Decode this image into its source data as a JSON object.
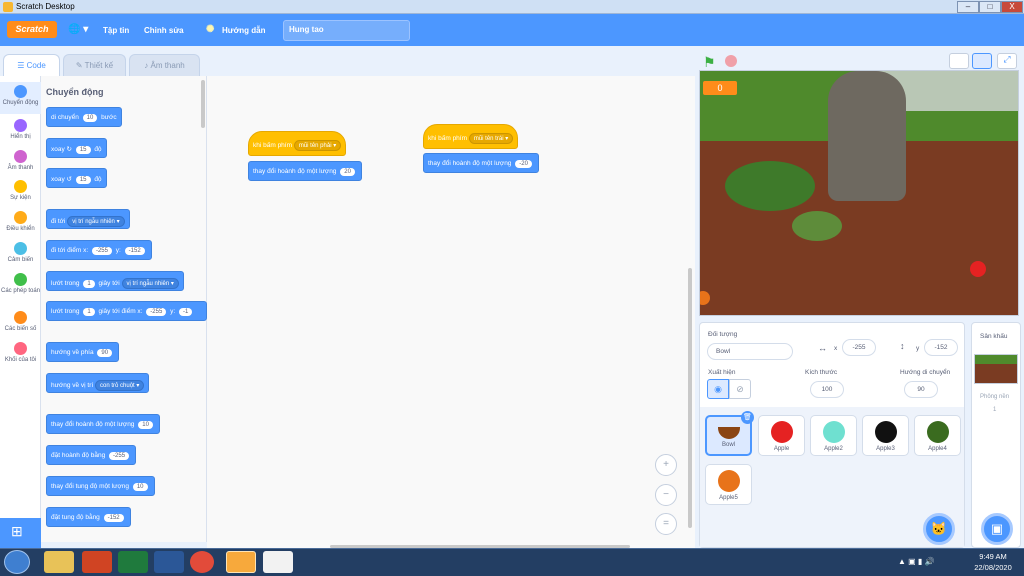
{
  "window": {
    "title": "Scratch Desktop",
    "min": "–",
    "max": "□",
    "close": "X"
  },
  "menubar": {
    "logo": "Scratch",
    "globe": "🌐 ▾",
    "file": "Tập tin",
    "edit": "Chỉnh sửa",
    "tutorials": "Hướng dẫn",
    "project_name": "Hung tao"
  },
  "tabs": {
    "code": "Code",
    "costumes": "Thiết kế",
    "sounds": "Âm thanh"
  },
  "categories": [
    {
      "label": "Chuyển động",
      "color": "#4c97ff"
    },
    {
      "label": "Hiển thị",
      "color": "#9966ff"
    },
    {
      "label": "Âm thanh",
      "color": "#cf63cf"
    },
    {
      "label": "Sự kiện",
      "color": "#ffbf00"
    },
    {
      "label": "Điều khiển",
      "color": "#ffab19"
    },
    {
      "label": "Cảm biến",
      "color": "#4cbfe6"
    },
    {
      "label": "Các phép toán",
      "color": "#40bf4a"
    },
    {
      "label": "Các biến số",
      "color": "#ff8c1a"
    },
    {
      "label": "Khối của tôi",
      "color": "#ff6680"
    }
  ],
  "palette": {
    "heading": "Chuyển động",
    "blocks": {
      "move": {
        "pre": "di chuyển",
        "v1": "10",
        "post": "bước"
      },
      "turn_right": {
        "pre": "xoay",
        "v1": "15",
        "post": "độ"
      },
      "turn_left": {
        "pre": "xoay",
        "v1": "15",
        "post": "độ"
      },
      "goto": {
        "pre": "đi tới",
        "dd": "vị trí ngẫu nhiên ▾"
      },
      "goto_xy": {
        "pre": "đi tới điểm x:",
        "v1": "-255",
        "mid": "y:",
        "v2": "-152"
      },
      "glide": {
        "pre": "lướt trong",
        "v1": "1",
        "mid": "giây tới",
        "dd": "vị trí ngẫu nhiên ▾"
      },
      "glide_xy": {
        "pre": "lướt trong",
        "v1": "1",
        "mid": "giây tới điểm x:",
        "v2": "-255",
        "end": "y:",
        "v3": "-1"
      },
      "point_dir": {
        "pre": "hướng về phía",
        "v1": "90"
      },
      "point_to": {
        "pre": "hướng về vị trí",
        "dd": "con trỏ chuột ▾"
      },
      "change_x": {
        "pre": "thay đổi hoành độ một lượng",
        "v1": "10"
      },
      "set_x": {
        "pre": "đặt hoành độ bằng",
        "v1": "-255"
      },
      "change_y": {
        "pre": "thay đổi tung độ một lượng",
        "v1": "10"
      },
      "set_y": {
        "pre": "đặt tung độ bằng",
        "v1": "-152"
      }
    }
  },
  "scripts": [
    {
      "hat": "khi bấm phím",
      "key": "mũi tên phải ▾",
      "action": "thay đổi hoành độ một lượng",
      "value": "20"
    },
    {
      "hat": "khi bấm phím",
      "key": "mũi tên trái ▾",
      "action": "thay đổi hoành độ một lượng",
      "value": "-20"
    }
  ],
  "zoom": {
    "in": "+",
    "out": "−",
    "reset": "="
  },
  "stage": {
    "score": "0"
  },
  "sprite_info": {
    "sprite_label": "Đối tượng",
    "sprite_name": "Bowl",
    "x_label": "x",
    "x_value": "-255",
    "y_label": "y",
    "y_value": "-152",
    "show_label": "Xuất hiện",
    "size_label": "Kích thước",
    "size_value": "100",
    "direction_label": "Hướng di chuyển",
    "direction_value": "90"
  },
  "sprites": [
    {
      "name": "Bowl",
      "color": "#8b4513"
    },
    {
      "name": "Apple",
      "color": "#e52222"
    },
    {
      "name": "Apple2",
      "color": "#6fe0d0"
    },
    {
      "name": "Apple3",
      "color": "#111111"
    },
    {
      "name": "Apple4",
      "color": "#3a6b1f"
    },
    {
      "name": "Apple5",
      "color": "#e8731a"
    }
  ],
  "stage_pane": {
    "title": "Sân khấu",
    "backdrops_label": "Phông nền",
    "backdrops_count": "1"
  },
  "taskbar": {
    "time": "9:49 AM",
    "date": "22/08/2020"
  }
}
